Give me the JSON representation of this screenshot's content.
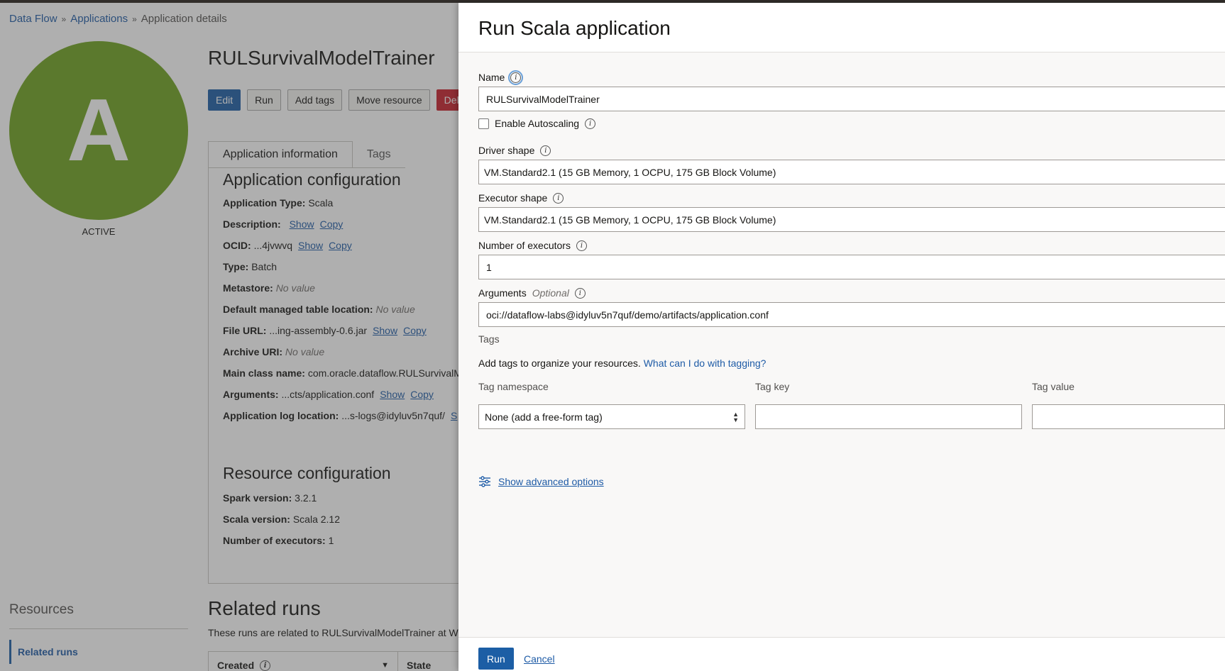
{
  "breadcrumb": {
    "dataflow": "Data Flow",
    "applications": "Applications",
    "current": "Application details"
  },
  "app": {
    "avatar_letter": "A",
    "status": "ACTIVE",
    "title": "RULSurvivalModelTrainer"
  },
  "actions": {
    "edit": "Edit",
    "run": "Run",
    "add_tags": "Add tags",
    "move": "Move resource",
    "delete": "Dele"
  },
  "tabs": {
    "info": "Application information",
    "tags": "Tags"
  },
  "app_config": {
    "title": "Application configuration",
    "type_label": "Application Type:",
    "type_value": "Scala",
    "desc_label": "Description:",
    "show": "Show",
    "copy": "Copy",
    "ocid_label": "OCID:",
    "ocid_value": "...4jvwvq",
    "btype_label": "Type:",
    "btype_value": "Batch",
    "metastore_label": "Metastore:",
    "no_value": "No value",
    "dmtl_label": "Default managed table location:",
    "file_label": "File URL:",
    "file_value": "...ing-assembly-0.6.jar",
    "archive_label": "Archive URI:",
    "main_label": "Main class name:",
    "main_value": "com.oracle.dataflow.RULSurvivalM",
    "args_label": "Arguments:",
    "args_value": "...cts/application.conf",
    "log_label": "Application log location:",
    "log_value": "...s-logs@idyluv5n7quf/",
    "log_link": "S"
  },
  "resource_config": {
    "title": "Resource configuration",
    "spark_label": "Spark version:",
    "spark_value": "3.2.1",
    "scala_label": "Scala version:",
    "scala_value": "Scala 2.12",
    "exec_label": "Number of executors:",
    "exec_value": "1"
  },
  "resources": {
    "title": "Resources",
    "related": "Related runs"
  },
  "related": {
    "title": "Related runs",
    "subtitle": "These runs are related to RULSurvivalModelTrainer at We",
    "col_created": "Created",
    "col_state": "State"
  },
  "drawer": {
    "title": "Run Scala application",
    "name_label": "Name",
    "name_value": "RULSurvivalModelTrainer",
    "autoscale_label": "Enable Autoscaling",
    "driver_label": "Driver shape",
    "driver_value": "VM.Standard2.1 (15 GB Memory, 1 OCPU, 175 GB Block Volume)",
    "executor_label": "Executor shape",
    "executor_value": "VM.Standard2.1 (15 GB Memory, 1 OCPU, 175 GB Block Volume)",
    "numexec_label": "Number of executors",
    "numexec_value": "1",
    "args_label": "Arguments",
    "args_optional": "Optional",
    "args_value": "oci://dataflow-labs@idyluv5n7quf/demo/artifacts/application.conf",
    "tags_heading": "Tags",
    "tags_desc": "Add tags to organize your resources.",
    "tags_link": "What can I do with tagging?",
    "tag_namespace_label": "Tag namespace",
    "tag_key_label": "Tag key",
    "tag_value_label": "Tag value",
    "tag_namespace_value": "None (add a free-form tag)",
    "advanced": "Show advanced options",
    "run": "Run",
    "cancel": "Cancel"
  },
  "icons": {
    "info": "i"
  }
}
